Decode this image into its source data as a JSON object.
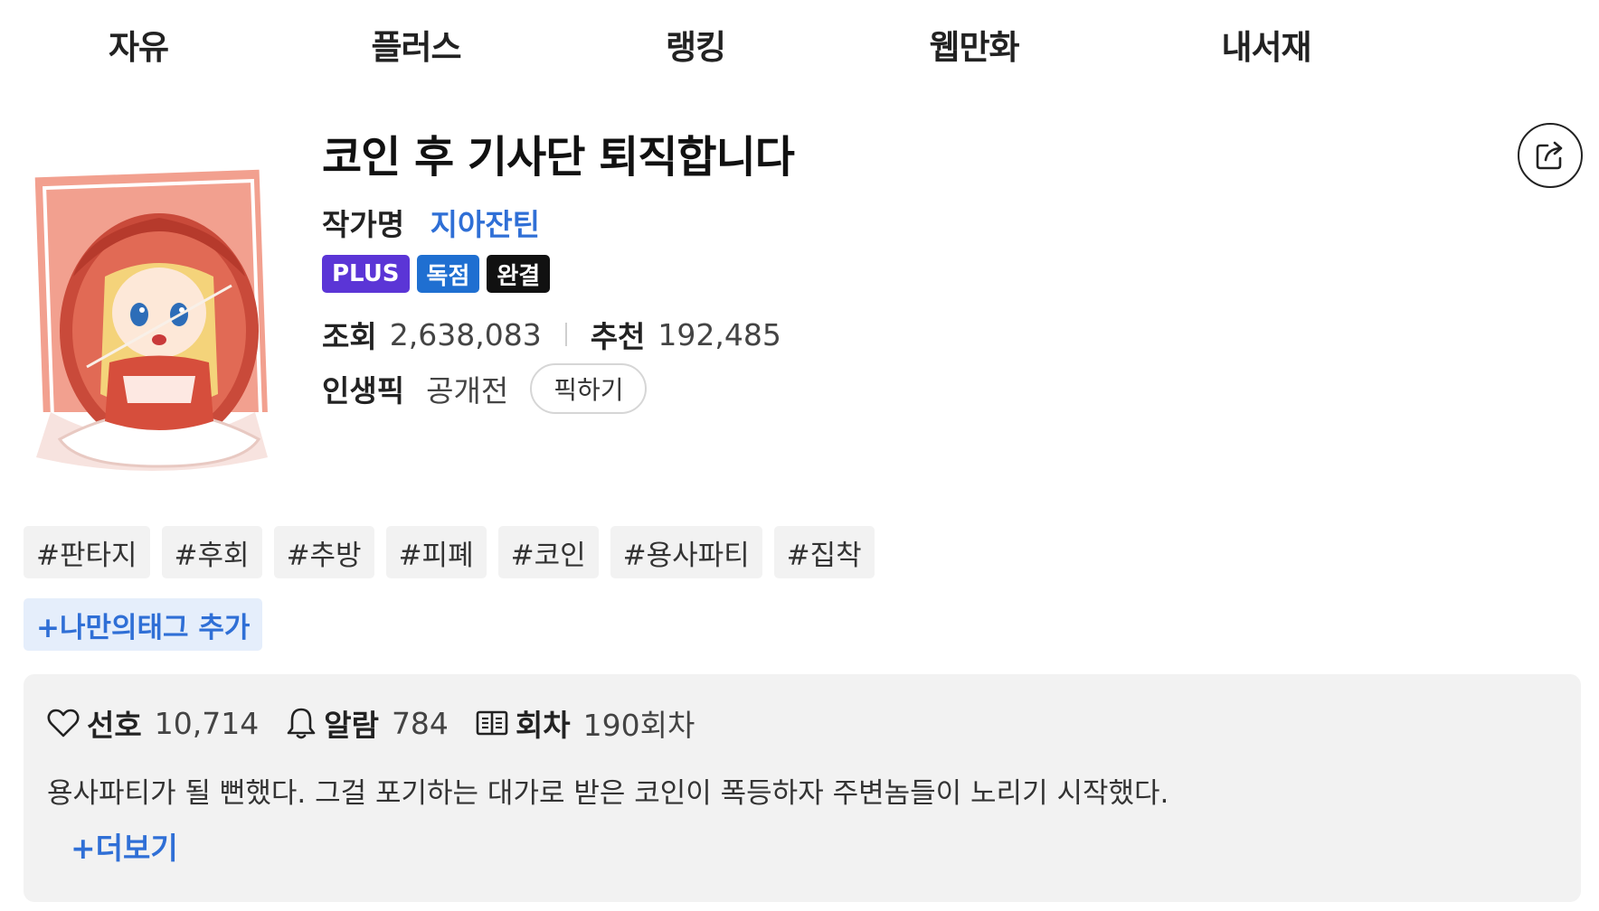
{
  "nav": {
    "items": [
      {
        "label": "자유"
      },
      {
        "label": "플러스"
      },
      {
        "label": "랭킹"
      },
      {
        "label": "웹만화"
      },
      {
        "label": "내서재"
      }
    ]
  },
  "novel": {
    "title": "코인 후 기사단 퇴직합니다",
    "author_label": "작가명",
    "author_name": "지아잔틴",
    "badges": [
      {
        "label": "PLUS",
        "color": "#5b35d6"
      },
      {
        "label": "독점",
        "color": "#1f6fd1"
      },
      {
        "label": "완결",
        "color": "#111111"
      }
    ],
    "views_label": "조회",
    "views_value": "2,638,083",
    "recommend_label": "추천",
    "recommend_value": "192,485",
    "pick_label": "인생픽",
    "pick_value": "공개전",
    "pick_button": "픽하기"
  },
  "tags": [
    "#판타지",
    "#후회",
    "#추방",
    "#피폐",
    "#코인",
    "#용사파티",
    "#집착"
  ],
  "add_tag_label": "+나만의태그 추가",
  "info": {
    "fav_label": "선호",
    "fav_value": "10,714",
    "alarm_label": "알람",
    "alarm_value": "784",
    "episodes_label": "회차",
    "episodes_value": "190회차",
    "synopsis": "용사파티가 될 뻔했다. 그걸 포기하는 대가로 받은 코인이 폭등하자 주변놈들이 노리기 시작했다.",
    "more_label": "+더보기"
  },
  "icons": {
    "share": "share-icon",
    "heart": "heart-icon",
    "bell": "bell-icon",
    "book": "book-icon"
  }
}
